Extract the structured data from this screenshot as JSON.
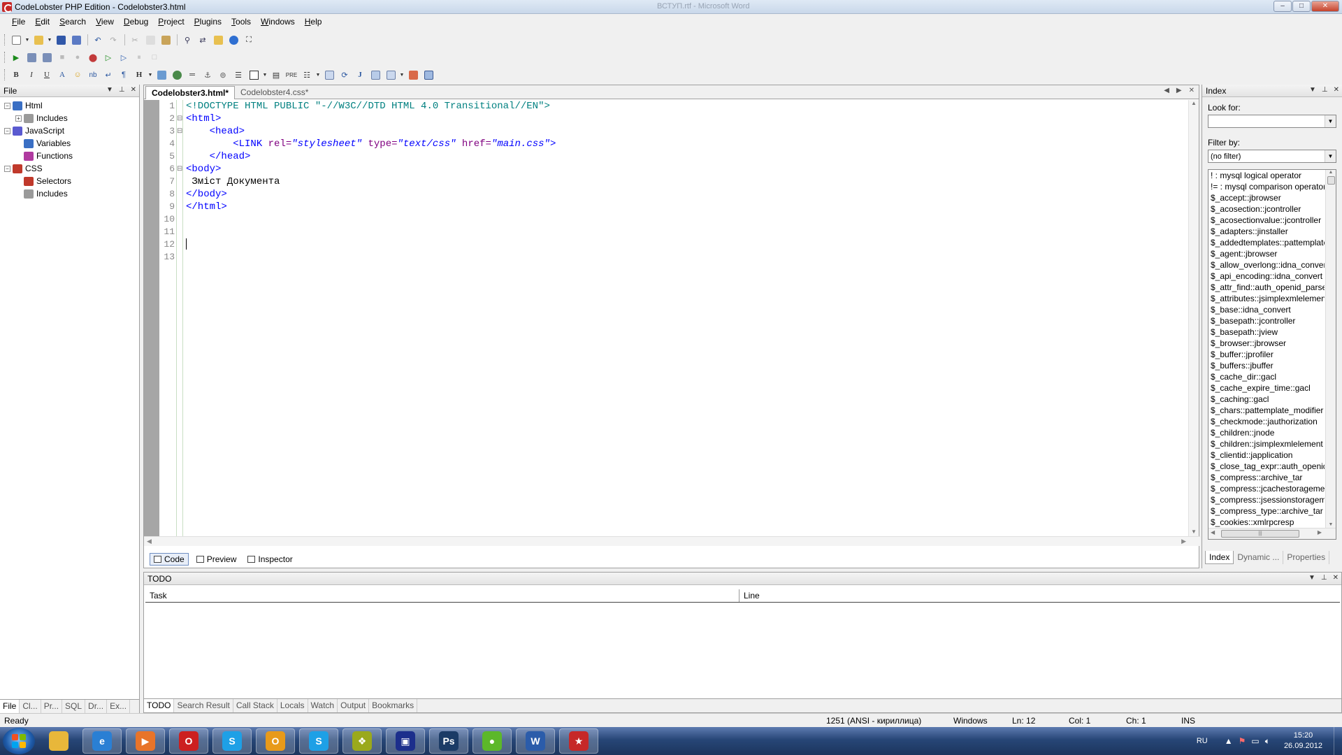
{
  "window": {
    "title": "CodeLobster PHP Edition - Codelobster3.html",
    "background_title": "ВСТУП.rtf - Microsoft Word",
    "controls": {
      "minimize": "–",
      "maximize": "□",
      "close": "✕"
    }
  },
  "menu": {
    "items": [
      {
        "label": "File",
        "u": "F",
        "rest": "ile"
      },
      {
        "label": "Edit",
        "u": "E",
        "rest": "dit"
      },
      {
        "label": "Search",
        "u": "S",
        "rest": "earch"
      },
      {
        "label": "View",
        "u": "V",
        "rest": "iew"
      },
      {
        "label": "Debug",
        "u": "D",
        "rest": "ebug"
      },
      {
        "label": "Project",
        "u": "P",
        "rest": "roject"
      },
      {
        "label": "Plugins",
        "u": "P",
        "rest": "lugins"
      },
      {
        "label": "Tools",
        "u": "T",
        "rest": "ools"
      },
      {
        "label": "Windows",
        "u": "W",
        "rest": "indows"
      },
      {
        "label": "Help",
        "u": "H",
        "rest": "elp"
      }
    ]
  },
  "format_toolbar": {
    "bold": "B",
    "italic": "I",
    "underline": "U",
    "font_color": "A",
    "nbsp": "nb",
    "paragraph": "¶",
    "heading": "H",
    "pre": "PRE",
    "jquery": "J"
  },
  "file_panel": {
    "title": "File",
    "tree": [
      {
        "label": "Html",
        "level": 0,
        "expander": "−",
        "icon_color": "#3a6fc4"
      },
      {
        "label": "Includes",
        "level": 1,
        "expander": "+",
        "icon_color": "#9a9a9a"
      },
      {
        "label": "JavaScript",
        "level": 0,
        "expander": "−",
        "icon_color": "#5a5ad0"
      },
      {
        "label": "Variables",
        "level": 1,
        "expander": "",
        "icon_color": "#3a6fc4"
      },
      {
        "label": "Functions",
        "level": 1,
        "expander": "",
        "icon_color": "#b03aa0"
      },
      {
        "label": "CSS",
        "level": 0,
        "expander": "−",
        "icon_color": "#c0392b"
      },
      {
        "label": "Selectors",
        "level": 1,
        "expander": "",
        "icon_color": "#c0392b"
      },
      {
        "label": "Includes",
        "level": 1,
        "expander": "",
        "icon_color": "#9a9a9a"
      }
    ],
    "bottom_tabs": [
      "File",
      "Cl...",
      "Pr...",
      "SQL",
      "Dr...",
      "Ex..."
    ]
  },
  "editor": {
    "tabs": [
      {
        "label": "Codelobster3.html*",
        "active": true
      },
      {
        "label": "Codelobster4.css*",
        "active": false
      }
    ],
    "line_numbers": [
      "1",
      "2",
      "3",
      "4",
      "5",
      "6",
      "7",
      "8",
      "9",
      "10",
      "11",
      "12",
      "13"
    ],
    "fold_marks": [
      "",
      "⊟",
      "⊟",
      "",
      "",
      "⊟",
      "",
      "",
      "",
      "",
      "",
      "",
      ""
    ],
    "code": {
      "l1": "<!DOCTYPE HTML PUBLIC \"-//W3C//DTD HTML 4.0 Transitional//EN\">",
      "l2": "<html>",
      "l3_indent": "    ",
      "l3": "<head>",
      "l4_indent": "        ",
      "l4_tag": "<LINK",
      "l4_a1": "rel=",
      "l4_v1": "\"stylesheet\"",
      "l4_a2": "type=",
      "l4_v2": "\"text/css\"",
      "l4_a3": "href=",
      "l4_v3": "\"main.css\"",
      "l4_end": ">",
      "l5_indent": "    ",
      "l5": "</head>",
      "l6": "<body>",
      "l7": " Зміст Документа",
      "l8": "</body>",
      "l9": "</html>"
    },
    "view_tabs": [
      {
        "label": "Code",
        "active": true
      },
      {
        "label": "Preview",
        "active": false
      },
      {
        "label": "Inspector",
        "active": false
      }
    ]
  },
  "index_panel": {
    "title": "Index",
    "look_for_label": "Look for:",
    "look_for_value": "",
    "filter_label": "Filter by:",
    "filter_value": "(no filter)",
    "items": [
      "! : mysql logical operator",
      "!= : mysql comparison operator",
      "$_accept::jbrowser",
      "$_acosection::jcontroller",
      "$_acosectionvalue::jcontroller",
      "$_adapters::jinstaller",
      "$_addedtemplates::pattemplate",
      "$_agent::jbrowser",
      "$_allow_overlong::idna_convert",
      "$_api_encoding::idna_convert",
      "$_attr_find::auth_openid_parse",
      "$_attributes::jsimplexmlelement",
      "$_base::idna_convert",
      "$_basepath::jcontroller",
      "$_basepath::jview",
      "$_browser::jbrowser",
      "$_buffer::jprofiler",
      "$_buffers::jbuffer",
      "$_cache_dir::gacl",
      "$_cache_expire_time::gacl",
      "$_caching::gacl",
      "$_chars::pattemplate_modifier",
      "$_checkmode::jauthorization",
      "$_children::jnode",
      "$_children::jsimplexmlelement",
      "$_clientid::japplication",
      "$_close_tag_expr::auth_openid",
      "$_compress::archive_tar",
      "$_compress::jcachestorageme",
      "$_compress::jsessionstoragem",
      "$_compress_type::archive_tar",
      "$_cookies::xmlrpcresp"
    ],
    "bottom_tabs": [
      {
        "label": "Index",
        "active": true
      },
      {
        "label": "Dynamic ...",
        "active": false
      },
      {
        "label": "Properties",
        "active": false
      }
    ],
    "hscroll_grip": "|||"
  },
  "todo_panel": {
    "title": "TODO",
    "columns": [
      "Task",
      "Line"
    ],
    "bottom_tabs": [
      {
        "label": "TODO",
        "active": true
      },
      {
        "label": "Search Result",
        "active": false
      },
      {
        "label": "Call Stack",
        "active": false
      },
      {
        "label": "Locals",
        "active": false
      },
      {
        "label": "Watch",
        "active": false
      },
      {
        "label": "Output",
        "active": false
      },
      {
        "label": "Bookmarks",
        "active": false
      }
    ]
  },
  "statusbar": {
    "ready": "Ready",
    "encoding": "1251 (ANSI - кириллица)",
    "line_endings": "Windows",
    "ln": "Ln: 12",
    "col": "Col: 1",
    "ch": "Ch: 1",
    "mode": "INS"
  },
  "taskbar": {
    "apps": [
      {
        "name": "explorer",
        "glyph": "",
        "color": "#e8b73a"
      },
      {
        "name": "internet-explorer",
        "glyph": "e",
        "color": "#2a7fd4"
      },
      {
        "name": "media-player",
        "glyph": "▶",
        "color": "#e8742a"
      },
      {
        "name": "opera",
        "glyph": "O",
        "color": "#cc1f1f"
      },
      {
        "name": "skype",
        "glyph": "S",
        "color": "#1ea0e6"
      },
      {
        "name": "outlook",
        "glyph": "O",
        "color": "#e89a1a"
      },
      {
        "name": "skype-2",
        "glyph": "S",
        "color": "#1ea0e6"
      },
      {
        "name": "app-yellow",
        "glyph": "❖",
        "color": "#9aa91c"
      },
      {
        "name": "save-app",
        "glyph": "▣",
        "color": "#1c2f8c"
      },
      {
        "name": "photoshop",
        "glyph": "Ps",
        "color": "#1b3b66"
      },
      {
        "name": "app-green",
        "glyph": "●",
        "color": "#5cb82a"
      },
      {
        "name": "word",
        "glyph": "W",
        "color": "#2b5caa"
      },
      {
        "name": "codelobster",
        "glyph": "★",
        "color": "#c62828"
      }
    ],
    "language": "RU",
    "time": "15:20",
    "date": "26.09.2012"
  }
}
